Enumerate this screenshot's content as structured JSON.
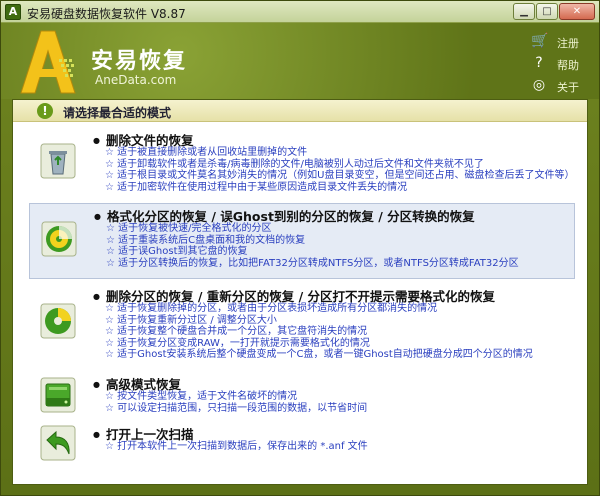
{
  "window": {
    "title": "安易硬盘数据恢复软件 V8.87",
    "app_icon_letter": "A",
    "min_glyph": "▁",
    "max_glyph": "□",
    "close_glyph": "✕"
  },
  "header": {
    "brand_cn": "安易恢复",
    "brand_en": "AneData.com",
    "links": [
      {
        "icon": "cart-icon",
        "glyph": "🛒",
        "label": "注册"
      },
      {
        "icon": "question-icon",
        "glyph": "?",
        "label": "帮助"
      },
      {
        "icon": "target-icon",
        "glyph": "◎",
        "label": "关于"
      }
    ]
  },
  "panel": {
    "title": "请选择最合适的模式",
    "warn_glyph": "!",
    "options": [
      {
        "title": "删除文件的恢复",
        "icon": "recycle-bin-icon",
        "lines": [
          "适于被直接删除或者从回收站里删掉的文件",
          "适于卸载软件或者是杀毒/病毒删除的文件/电脑被别人动过后文件和文件夹就不见了",
          "适于根目录或文件莫名其妙消失的情况（例如U盘目录变空，但是空间还占用、磁盘检查后丢了文件等）",
          "适于加密软件在使用过程中由于某些原因造成目录文件丢失的情况"
        ]
      },
      {
        "title": "格式化分区的恢复 / 误Ghost到别的分区的恢复 / 分区转换的恢复",
        "icon": "disk-format-icon",
        "lines": [
          "适于恢复被快速/完全格式化的分区",
          "适于重装系统后C盘桌面和我的文档的恢复",
          "适于误Ghost到其它盘的恢复",
          "适于分区转换后的恢复，比如把FAT32分区转成NTFS分区，或者NTFS分区转成FAT32分区"
        ]
      },
      {
        "title": "删除分区的恢复 / 重新分区的恢复 / 分区打不开提示需要格式化的恢复",
        "icon": "partition-icon",
        "lines": [
          "适于恢复删除掉的分区，或者由于分区表损坏造成所有分区都消失的情况",
          "适于恢复重新分过区 / 调整分区大小",
          "适于恢复整个硬盘合并成一个分区，其它盘符消失的情况",
          "适于恢复分区变成RAW，一打开就提示需要格式化的情况",
          "适于Ghost安装系统后整个硬盘变成一个C盘，或者一键Ghost自动把硬盘分成四个分区的情况"
        ]
      },
      {
        "title": "高级模式恢复",
        "icon": "hard-drive-icon",
        "lines": [
          "按文件类型恢复，适于文件名破坏的情况",
          "可以设定扫描范围，只扫描一段范围的数据，以节省时间"
        ]
      },
      {
        "title": "打开上一次扫描",
        "icon": "back-arrow-icon",
        "lines": [
          "打开本软件上一次扫描到数据后，保存出来的 *.anf 文件"
        ]
      }
    ]
  }
}
